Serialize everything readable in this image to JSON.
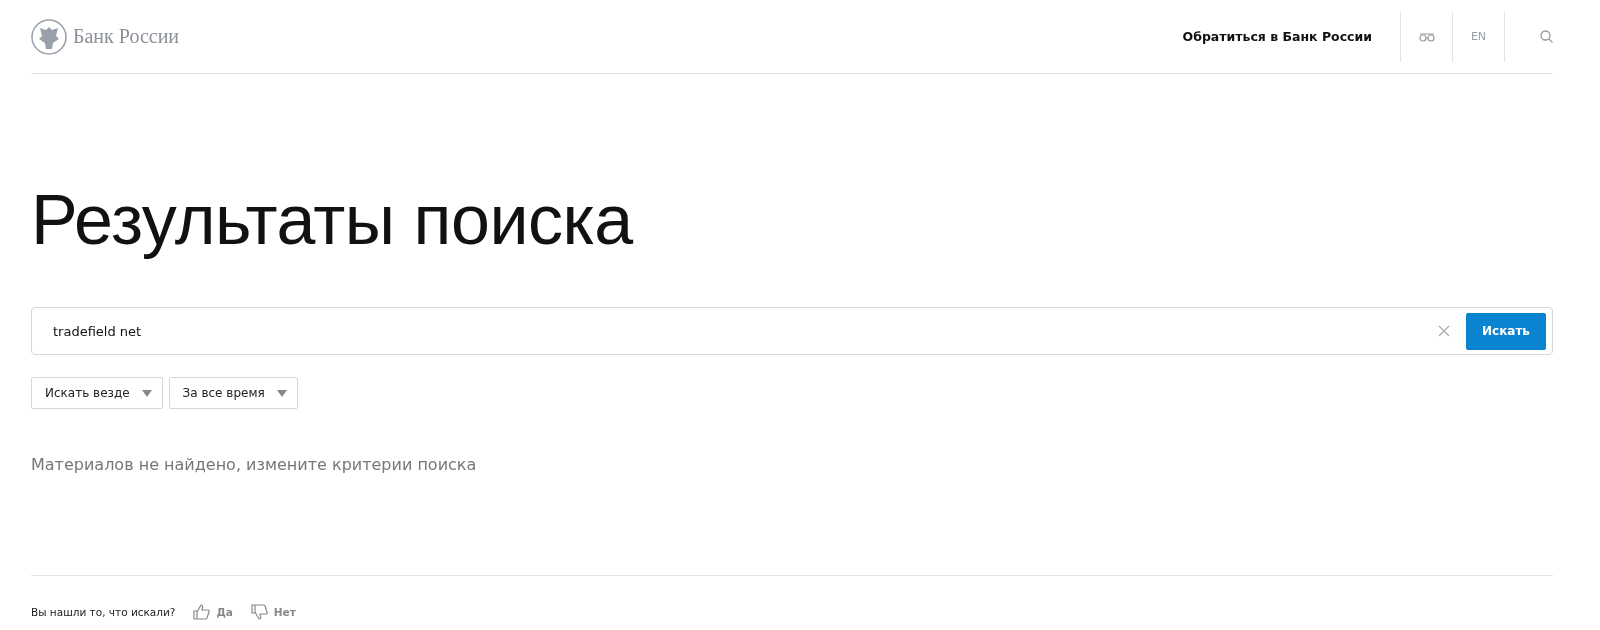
{
  "header": {
    "logo_text": "Банк России",
    "contact_link": "Обратиться в Банк России",
    "language": "EN"
  },
  "title": "Результаты поиска",
  "search": {
    "value": "tradefield net",
    "button": "Искать"
  },
  "filters": [
    {
      "label": "Искать везде"
    },
    {
      "label": "За все время"
    }
  ],
  "message": "Материалов не найдено, измените критерии поиска",
  "feedback": {
    "question": "Вы нашли то, что искали?",
    "yes": "Да",
    "no": "Нет"
  }
}
